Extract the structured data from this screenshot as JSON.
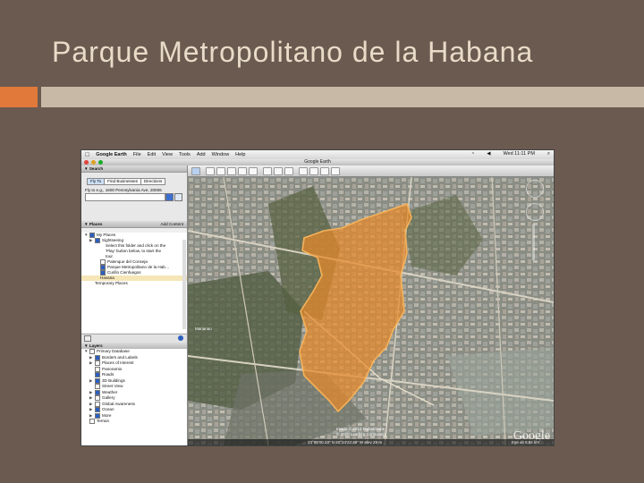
{
  "slide": {
    "title": "Parque Metropolitano de la Habana"
  },
  "menubar": {
    "app": "Google Earth",
    "items": [
      "File",
      "Edit",
      "View",
      "Tools",
      "Add",
      "Window",
      "Help"
    ],
    "clock": "Wed 11:11 PM"
  },
  "window": {
    "title": "Google Earth"
  },
  "search": {
    "header": "Search",
    "tabs": [
      "Fly To",
      "Find Businesses",
      "Directions"
    ],
    "fly_to_label": "Fly to e.g., 1600 Pennsylvania Ave, 20006"
  },
  "places": {
    "header": "Places",
    "add_content": "Add Content",
    "items": [
      {
        "label": "My Places",
        "indent": 0,
        "tri": "▼",
        "chk": true,
        "hl": false
      },
      {
        "label": "Sightseeing",
        "indent": 1,
        "tri": "▶",
        "chk": true,
        "hl": false
      },
      {
        "label": "Select this folder and click on the",
        "indent": 3,
        "tri": "",
        "chk": null,
        "hl": false
      },
      {
        "label": "'Play' button below, to start the",
        "indent": 3,
        "tri": "",
        "chk": null,
        "hl": false
      },
      {
        "label": "tour.",
        "indent": 3,
        "tri": "",
        "chk": null,
        "hl": false
      },
      {
        "label": "Palenque del Conseja",
        "indent": 2,
        "tri": "",
        "chk": false,
        "hl": false
      },
      {
        "label": "Parque Metropolitano de la Hab…",
        "indent": 2,
        "tri": "",
        "chk": true,
        "hl": false
      },
      {
        "label": "Curillo Cienfuegos",
        "indent": 2,
        "tri": "",
        "chk": true,
        "hl": false
      },
      {
        "label": "Havana",
        "indent": 2,
        "tri": "",
        "chk": null,
        "hl": true
      },
      {
        "label": "Temporary Places",
        "indent": 1,
        "tri": "",
        "chk": null,
        "hl": false
      }
    ]
  },
  "layers": {
    "header": "Layers",
    "items": [
      {
        "label": "Primary Database",
        "indent": 0,
        "tri": "▼",
        "chk": false
      },
      {
        "label": "Borders and Labels",
        "indent": 1,
        "tri": "▶",
        "chk": true
      },
      {
        "label": "Places of Interest",
        "indent": 1,
        "tri": "▶",
        "chk": false
      },
      {
        "label": "Panoramio",
        "indent": 1,
        "tri": "",
        "chk": false
      },
      {
        "label": "Roads",
        "indent": 1,
        "tri": "",
        "chk": true
      },
      {
        "label": "3D Buildings",
        "indent": 1,
        "tri": "▶",
        "chk": true
      },
      {
        "label": "Street View",
        "indent": 1,
        "tri": "",
        "chk": false
      },
      {
        "label": "Weather",
        "indent": 1,
        "tri": "▶",
        "chk": true
      },
      {
        "label": "Gallery",
        "indent": 1,
        "tri": "▶",
        "chk": false
      },
      {
        "label": "Global Awareness",
        "indent": 1,
        "tri": "▶",
        "chk": false
      },
      {
        "label": "Ocean",
        "indent": 1,
        "tri": "▶",
        "chk": true
      },
      {
        "label": "More",
        "indent": 1,
        "tri": "▶",
        "chk": true
      },
      {
        "label": "Terrain",
        "indent": 0,
        "tri": "",
        "chk": false
      }
    ]
  },
  "map": {
    "attribution_1": "Image © 2010 DigitalGlobe",
    "attribution_2": "© 2010 Leadorg Consulting",
    "coords": "23°05'00.23\" N    82°24'22.48\" W  elev   29 m",
    "eye_alt": "Eye alt    5.82 km",
    "google_logo": "Google",
    "label_marianao": "Marianao",
    "polygon_color": "#e8892a"
  }
}
